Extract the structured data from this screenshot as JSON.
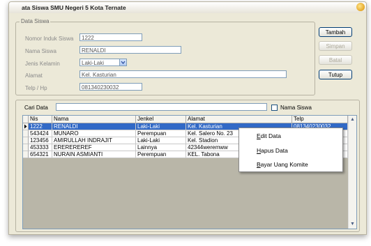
{
  "window": {
    "title": "ata Siswa SMU Negeri 5 Kota Ternate"
  },
  "form": {
    "group_label": "Data Siswa",
    "nis_label": "Nomor Induk Siswa",
    "nis_value": "1222",
    "nama_label": "Nama Siswa",
    "nama_value": "RENALDI",
    "jenkel_label": "Jenis Kelamin",
    "jenkel_value": "Laki-Laki",
    "alamat_label": "Alamat",
    "alamat_value": "Kel. Kasturian",
    "telp_label": "Telp / Hp",
    "telp_value": "081340230032"
  },
  "buttons": {
    "tambah": "Tambah",
    "simpan": "Simpan",
    "batal": "Batal",
    "tutup": "Tutup"
  },
  "search": {
    "label": "Cari Data",
    "value": "",
    "checkbox_label": "Nama Siswa",
    "checked": false
  },
  "table": {
    "columns": [
      "Nis",
      "Nama",
      "Jenkel",
      "Alamat",
      "Telp"
    ],
    "rows": [
      [
        "1222",
        "RENALDI",
        "Laki-Laki",
        "Kel. Kasturian",
        "081340230032"
      ],
      [
        "543424",
        "MUNARO",
        "Perempuan",
        "Kel. Salero No. 23",
        ""
      ],
      [
        "123456",
        "AMIRULLAH INDRAJIT",
        "Laki-Laki",
        "Kel. Stadion",
        ""
      ],
      [
        "453333",
        "EREREREREF",
        "Lainnya",
        "42344weremww",
        ""
      ],
      [
        "654321",
        "NURAIN ASMIANTI",
        "Perempuan",
        "KEL. Tabona",
        ""
      ]
    ],
    "selected_row": 0
  },
  "context_menu": {
    "items": [
      {
        "pre": "",
        "ul": "E",
        "post": "dit Data"
      },
      {
        "pre": "",
        "ul": "H",
        "post": "apus Data"
      },
      {
        "pre": "",
        "ul": "B",
        "post": "ayar Uang Komite"
      }
    ]
  },
  "colors": {
    "selection": "#3169c6",
    "window_bg": "#ece9d8"
  }
}
